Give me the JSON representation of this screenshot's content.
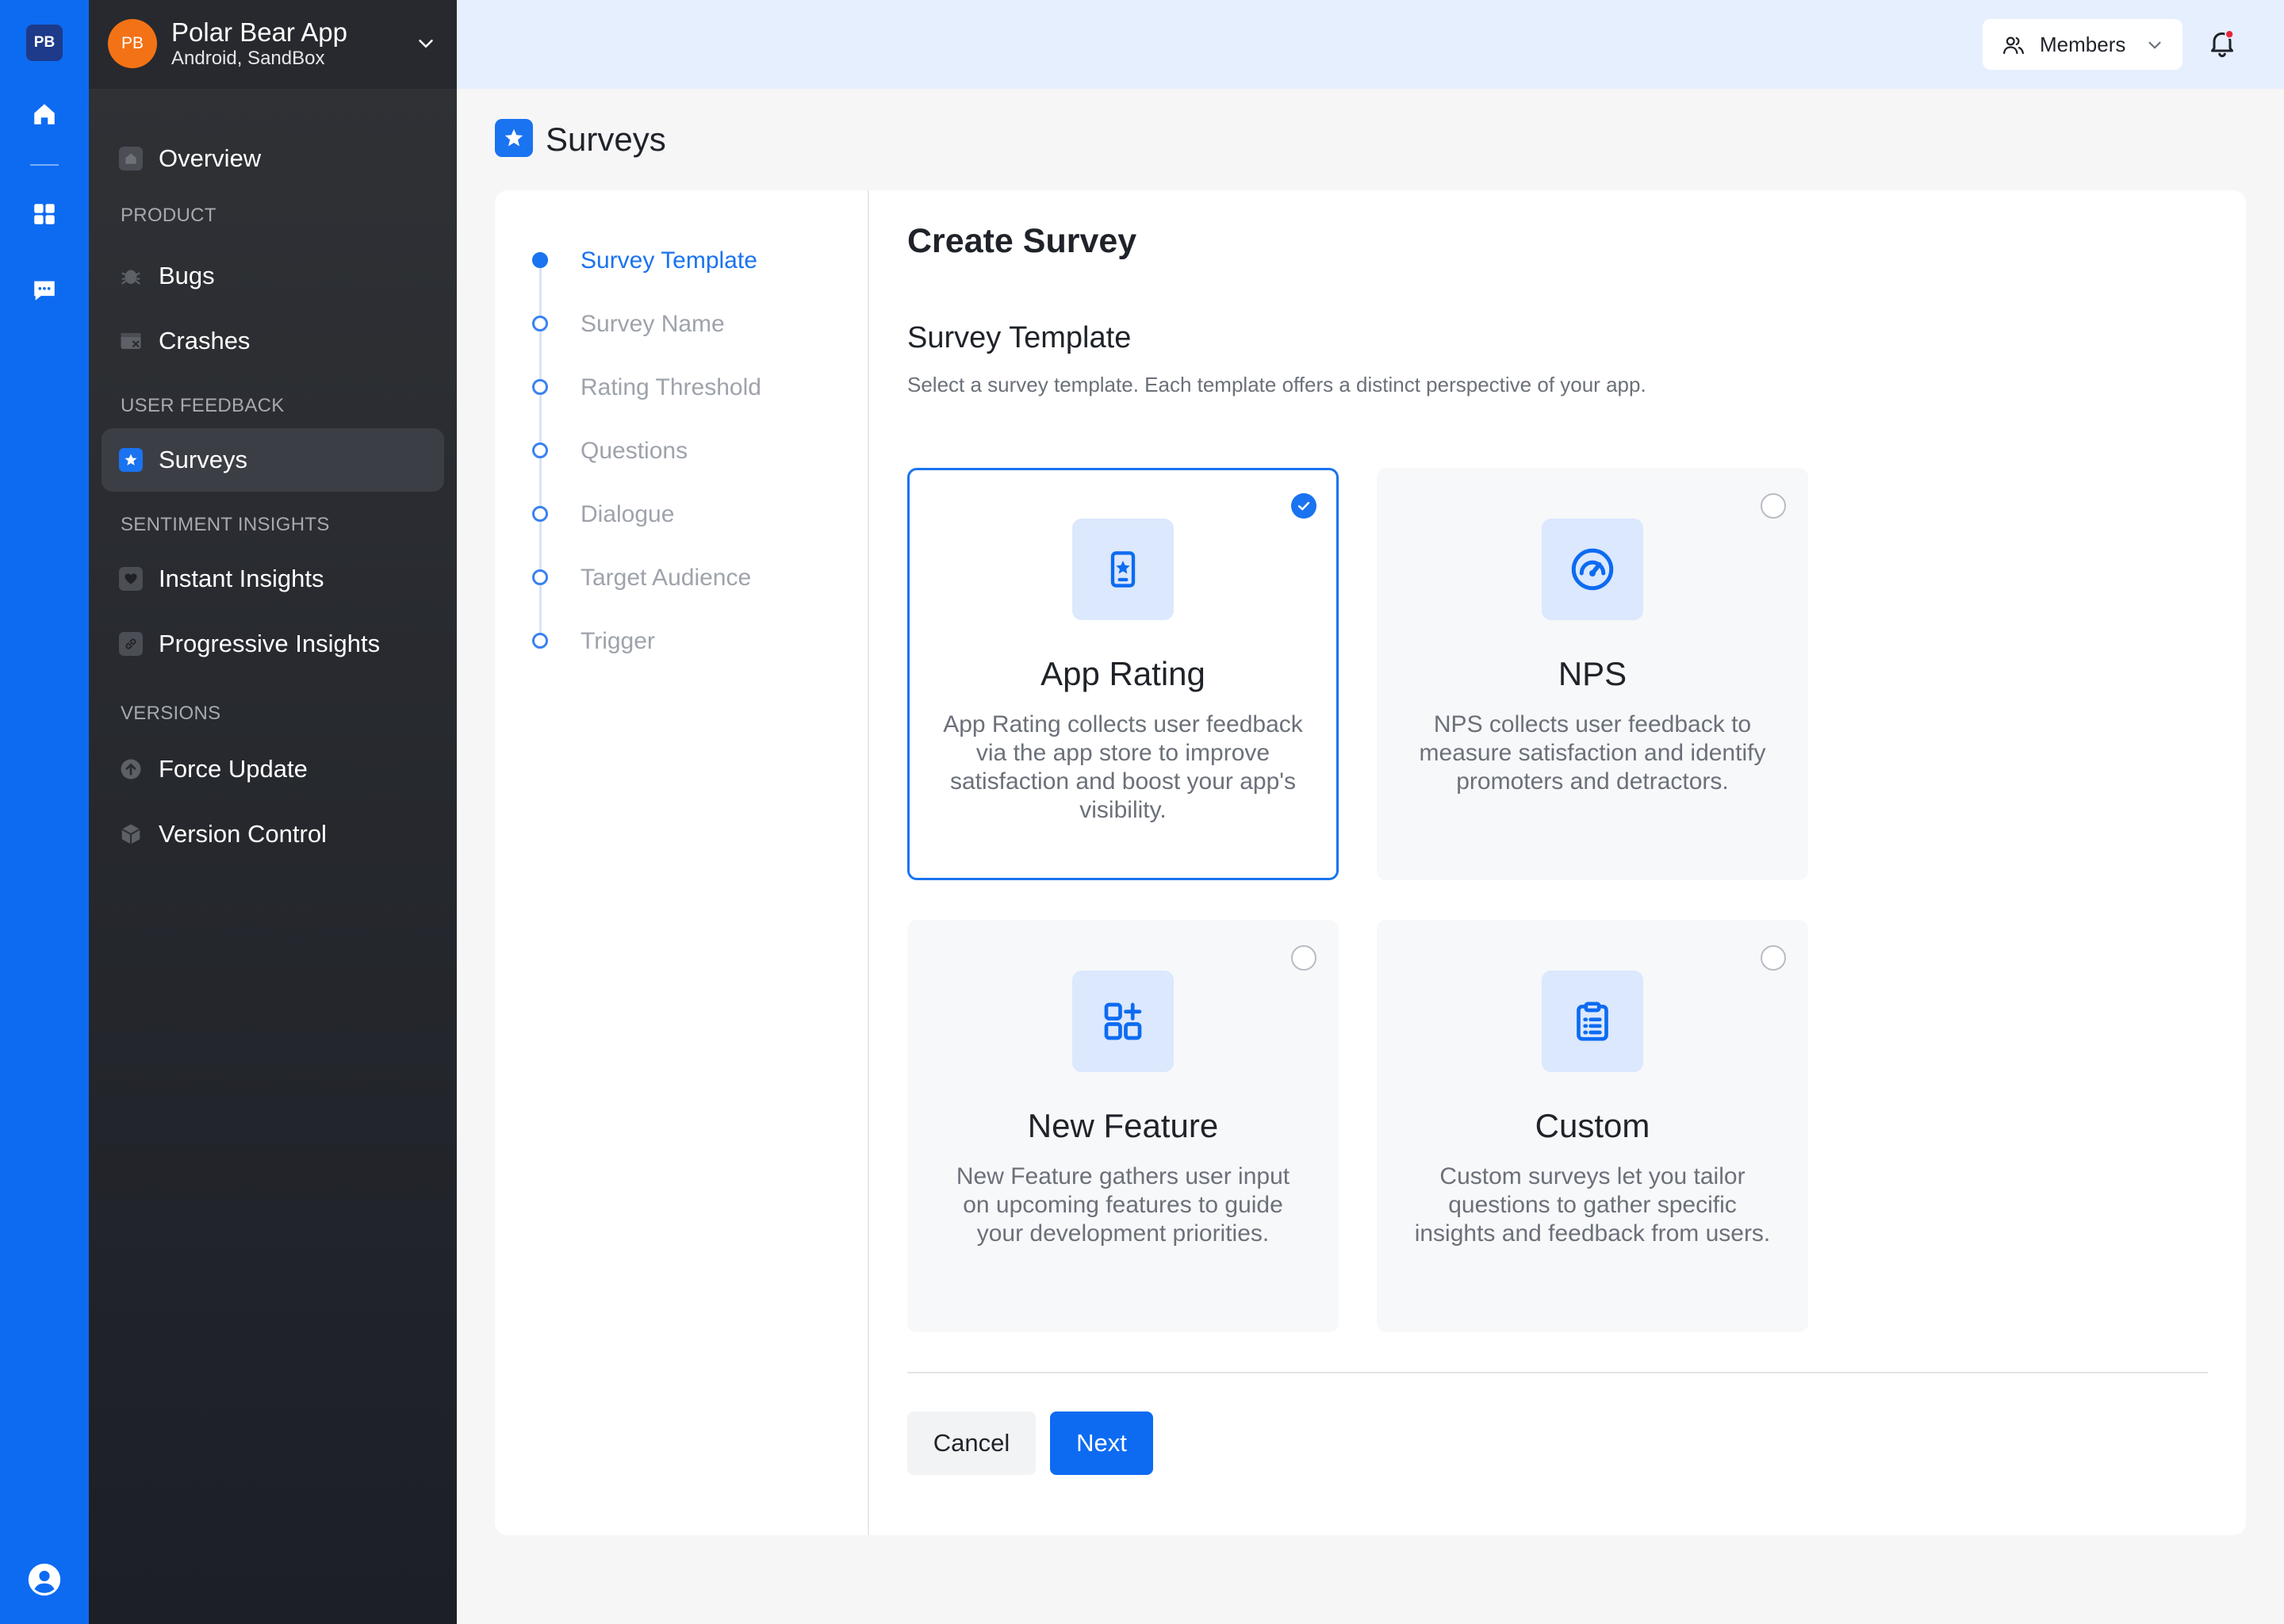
{
  "rail": {
    "logo": "PB"
  },
  "app": {
    "avatar": "PB",
    "name": "Polar Bear App",
    "subtitle": "Android, SandBox"
  },
  "sidebar": {
    "overview": "Overview",
    "sections": {
      "product": "PRODUCT",
      "user_feedback": "USER FEEDBACK",
      "sentiment": "SENTIMENT INSIGHTS",
      "versions": "VERSIONS"
    },
    "items": {
      "bugs": "Bugs",
      "crashes": "Crashes",
      "surveys": "Surveys",
      "instant": "Instant Insights",
      "progressive": "Progressive Insights",
      "force_update": "Force Update",
      "version_control": "Version Control"
    }
  },
  "topbar": {
    "members_label": "Members"
  },
  "page": {
    "title": "Surveys"
  },
  "steps": [
    {
      "label": "Survey Template",
      "active": true
    },
    {
      "label": "Survey Name",
      "active": false
    },
    {
      "label": "Rating Threshold",
      "active": false
    },
    {
      "label": "Questions",
      "active": false
    },
    {
      "label": "Dialogue",
      "active": false
    },
    {
      "label": "Target Audience",
      "active": false
    },
    {
      "label": "Trigger",
      "active": false
    }
  ],
  "form": {
    "title": "Create Survey",
    "section_title": "Survey Template",
    "section_desc": "Select a survey template. Each template offers a distinct perspective of your app."
  },
  "templates": [
    {
      "name": "App Rating",
      "desc": "App Rating collects user feedback via the app store to improve satisfaction and boost your app's visibility.",
      "selected": true,
      "icon": "phone-star-icon"
    },
    {
      "name": "NPS",
      "desc": "NPS collects user feedback to measure satisfaction and identify promoters and detractors.",
      "selected": false,
      "icon": "gauge-icon"
    },
    {
      "name": "New Feature",
      "desc": "New Feature gathers user input on upcoming features to guide your development priorities.",
      "selected": false,
      "icon": "grid-plus-icon"
    },
    {
      "name": "Custom",
      "desc": "Custom surveys let you tailor questions to gather specific insights and feedback from users.",
      "selected": false,
      "icon": "clipboard-list-icon"
    }
  ],
  "actions": {
    "cancel": "Cancel",
    "next": "Next"
  },
  "colors": {
    "accent": "#0d6bf2",
    "sidebar_bg": "#1c1f26",
    "avatar": "#f47216"
  }
}
